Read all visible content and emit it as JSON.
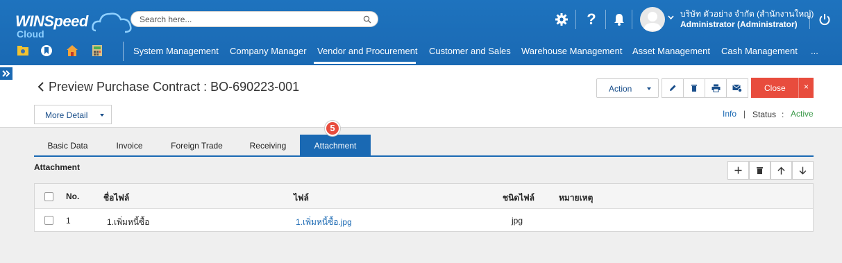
{
  "app": {
    "logo_main": "WINSpeed",
    "logo_sub": "Cloud"
  },
  "search": {
    "placeholder": "Search here..."
  },
  "user": {
    "company": "บริษัท ตัวอย่าง จำกัด (สำนักงานใหญ่)",
    "role": "Administrator (Administrator)"
  },
  "menu": [
    "System Management",
    "Company Manager",
    "Vendor and Procurement",
    "Customer and Sales",
    "Warehouse Management",
    "Asset Management",
    "Cash Management",
    "..."
  ],
  "page": {
    "title": "Preview Purchase Contract : BO-690223-001",
    "action_label": "Action",
    "close_label": "Close",
    "close_x": "×",
    "more_detail_label": "More Detail",
    "info_label": "Info",
    "info_sep": "|",
    "status_label": "Status",
    "status_colon": ":",
    "status_value": "Active"
  },
  "tabs": [
    "Basic Data",
    "Invoice",
    "Foreign Trade",
    "Receiving",
    "Attachment"
  ],
  "step_badge": "5",
  "attachment": {
    "section_title": "Attachment",
    "columns": [
      "No.",
      "ชื่อไฟล์",
      "ไฟล์",
      "ชนิดไฟล์",
      "หมายเหตุ"
    ],
    "rows": [
      {
        "no": "1",
        "name": "1.เพิ่มหนี้ซื้อ",
        "file": "1.เพิ่มหนี้ซื้อ.jpg",
        "type": "jpg",
        "note": ""
      }
    ]
  },
  "colors": {
    "brand_blue": "#1a69b3",
    "close_red": "#e84c3d",
    "status_green": "#3c9a4a"
  }
}
